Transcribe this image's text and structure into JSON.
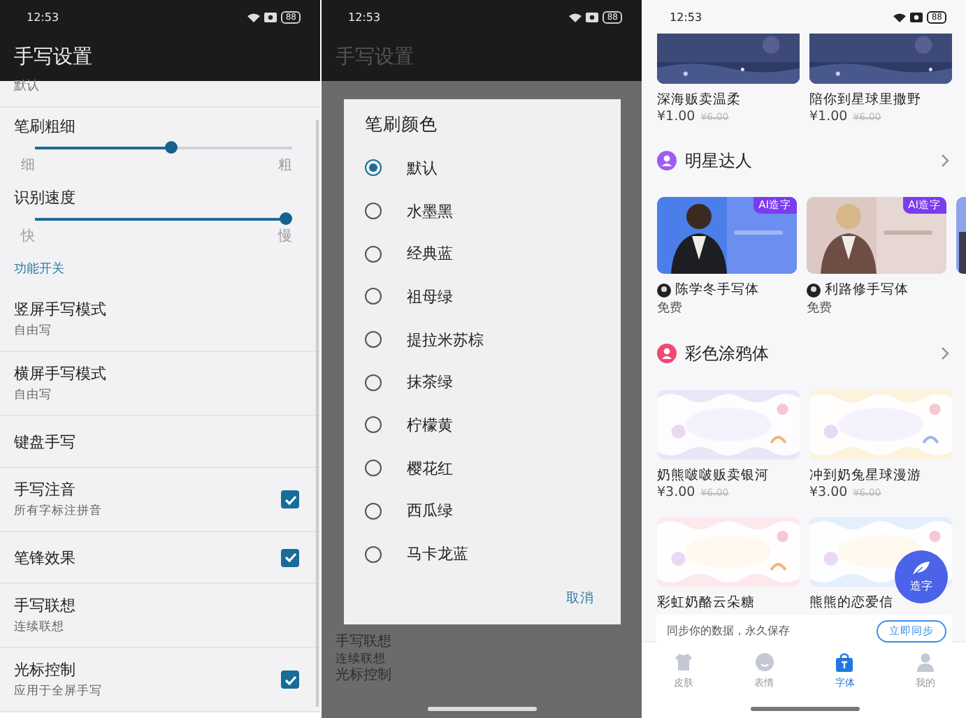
{
  "settings_screen": {
    "time": "12:53",
    "battery": "88",
    "title": "手写设置",
    "items": [
      {
        "kind": "tail",
        "title": "默认"
      },
      {
        "kind": "slider",
        "title": "笔刷粗细",
        "level": 0.53,
        "min_label": "细",
        "max_label": "粗"
      },
      {
        "kind": "slider",
        "title": "识别速度",
        "level": 1,
        "min_label": "快",
        "max_label": "慢"
      },
      {
        "kind": "section",
        "title": "功能开关"
      },
      {
        "kind": "option",
        "title": "竖屏手写模式",
        "subtitle": "自由写"
      },
      {
        "kind": "option",
        "title": "横屏手写模式",
        "subtitle": "自由写"
      },
      {
        "kind": "option",
        "title": "键盘手写"
      },
      {
        "kind": "check",
        "title": "手写注音",
        "subtitle": "所有字标注拼音",
        "checked": true
      },
      {
        "kind": "check",
        "title": "笔锋效果",
        "checked": true
      },
      {
        "kind": "option",
        "title": "手写联想",
        "subtitle": "连续联想"
      },
      {
        "kind": "check",
        "title": "光标控制",
        "subtitle": "应用于全屏手写",
        "checked": true
      }
    ]
  },
  "dialog_screen": {
    "time": "12:53",
    "battery": "88",
    "title": "手写设置",
    "visible_rows": [
      {
        "title": "手写联想",
        "subtitle": "连续联想"
      },
      {
        "title": "光标控制"
      }
    ],
    "dialog": {
      "title": "笔刷颜色",
      "options": [
        {
          "label": "默认",
          "selected": true
        },
        {
          "label": "水墨黑",
          "selected": false
        },
        {
          "label": "经典蓝",
          "selected": false
        },
        {
          "label": "祖母绿",
          "selected": false
        },
        {
          "label": "提拉米苏棕",
          "selected": false
        },
        {
          "label": "抹茶绿",
          "selected": false
        },
        {
          "label": "柠檬黄",
          "selected": false
        },
        {
          "label": "樱花红",
          "selected": false
        },
        {
          "label": "西瓜绿",
          "selected": false
        },
        {
          "label": "马卡龙蓝",
          "selected": false
        }
      ],
      "cancel": "取消"
    }
  },
  "store_screen": {
    "time": "12:53",
    "battery": "88",
    "top_products": [
      {
        "name": "深海贩卖温柔",
        "price": "¥1.00",
        "old_price": "¥6.00"
      },
      {
        "name": "陪你到星球里撒野",
        "price": "¥1.00",
        "old_price": "¥6.00"
      }
    ],
    "sections": [
      {
        "kind": "star",
        "title": "明星达人",
        "color": "#a05cf2",
        "cards": [
          {
            "name": "陈学冬手写体",
            "price": "免费",
            "badge": "AI造字"
          },
          {
            "name": "利路修手写体",
            "price": "免费",
            "badge": "AI造字"
          }
        ]
      },
      {
        "kind": "doodle",
        "title": "彩色涂鸦体",
        "color": "#f04a72",
        "cards": [
          {
            "name": "奶熊啵啵贩卖银河",
            "price": "¥3.00",
            "old_price": "¥6.00"
          },
          {
            "name": "冲到奶兔星球漫游",
            "price": "¥3.00",
            "old_price": "¥6.00"
          },
          {
            "name": "彩虹奶酪云朵糖"
          },
          {
            "name": "熊熊的恋爱信"
          }
        ]
      }
    ],
    "fab": "造字",
    "sync": {
      "text": "同步你的数据，永久保存",
      "button": "立即同步"
    },
    "nav": [
      {
        "label": "皮肤",
        "selected": false
      },
      {
        "label": "表情",
        "selected": false
      },
      {
        "label": "字体",
        "selected": true
      },
      {
        "label": "我的",
        "selected": false
      }
    ]
  }
}
